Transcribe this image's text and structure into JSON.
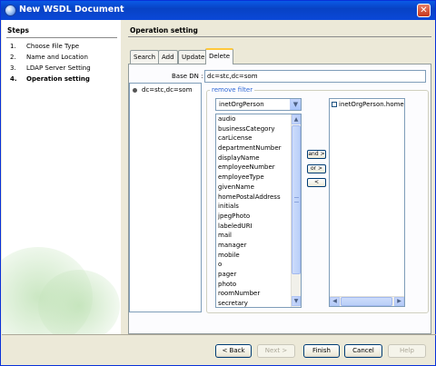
{
  "window": {
    "title": "New WSDL Document"
  },
  "steps": {
    "heading": "Steps",
    "items": [
      {
        "num": "1.",
        "label": "Choose File Type",
        "current": false
      },
      {
        "num": "2.",
        "label": "Name and Location",
        "current": false
      },
      {
        "num": "3.",
        "label": "LDAP Server Setting",
        "current": false
      },
      {
        "num": "4.",
        "label": "Operation setting",
        "current": true
      }
    ]
  },
  "main": {
    "heading": "Operation setting",
    "tabs": [
      "Search",
      "Add",
      "Update",
      "Delete"
    ],
    "active_tab": "Delete",
    "base_dn_label": "Base DN :",
    "base_dn_value": "dc=stc,dc=som",
    "tree_node": "dc=stc,dc=som",
    "remove_filter_label": "remove filter",
    "object_class": "inetOrgPerson",
    "attributes": [
      "audio",
      "businessCategory",
      "carLicense",
      "departmentNumber",
      "displayName",
      "employeeNumber",
      "employeeType",
      "givenName",
      "homePostalAddress",
      "initials",
      "jpegPhoto",
      "labeledURI",
      "mail",
      "manager",
      "mobile",
      "o",
      "pager",
      "photo",
      "roomNumber",
      "secretary"
    ],
    "move_buttons": {
      "and": "and >",
      "or": "or >",
      "remove": "<"
    },
    "selected_filters": [
      "inetOrgPerson.homePh"
    ]
  },
  "buttons": {
    "back": "< Back",
    "next": "Next >",
    "finish": "Finish",
    "cancel": "Cancel",
    "help": "Help"
  }
}
